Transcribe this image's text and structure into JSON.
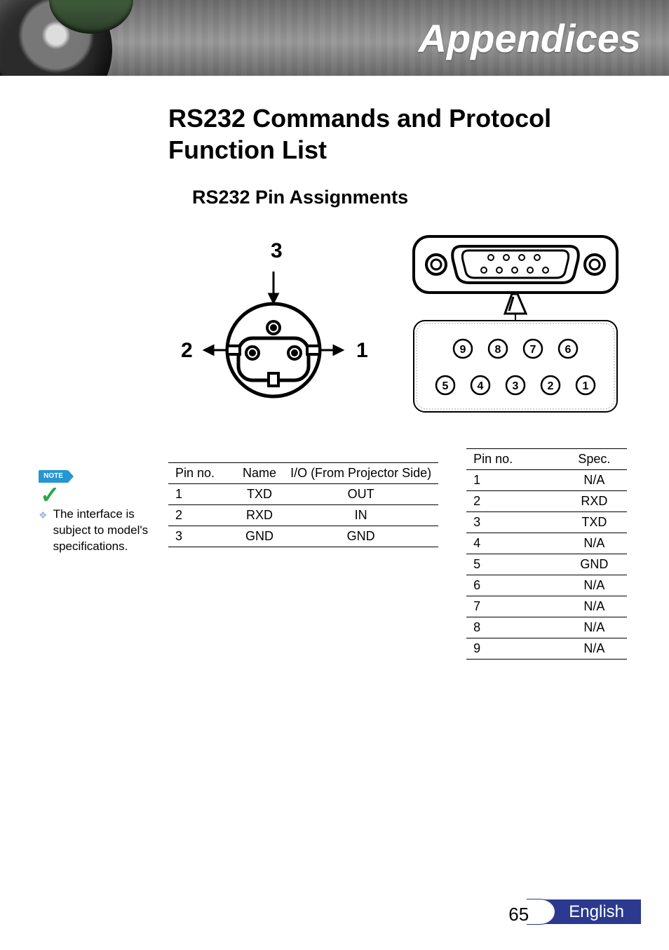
{
  "header": {
    "title": "Appendices"
  },
  "headings": {
    "h1": "RS232 Commands and Protocol Function List",
    "h2": "RS232 Pin Assignments"
  },
  "note": {
    "badge": "NOTE",
    "text": "The interface is subject to model's specifications."
  },
  "diagram_round": {
    "labels": {
      "top": "3",
      "left": "2",
      "right": "1"
    }
  },
  "diagram_db9": {
    "top_row": [
      "9",
      "8",
      "7",
      "6"
    ],
    "bottom_row": [
      "5",
      "4",
      "3",
      "2",
      "1"
    ]
  },
  "table3": {
    "headers": [
      "Pin no.",
      "Name",
      "I/O (From Projector Side)"
    ],
    "rows": [
      [
        "1",
        "TXD",
        "OUT"
      ],
      [
        "2",
        "RXD",
        "IN"
      ],
      [
        "3",
        "GND",
        "GND"
      ]
    ]
  },
  "table9": {
    "headers": [
      "Pin no.",
      "Spec."
    ],
    "rows": [
      [
        "1",
        "N/A"
      ],
      [
        "2",
        "RXD"
      ],
      [
        "3",
        "TXD"
      ],
      [
        "4",
        "N/A"
      ],
      [
        "5",
        "GND"
      ],
      [
        "6",
        "N/A"
      ],
      [
        "7",
        "N/A"
      ],
      [
        "8",
        "N/A"
      ],
      [
        "9",
        "N/A"
      ]
    ]
  },
  "footer": {
    "page": "65",
    "language": "English"
  }
}
